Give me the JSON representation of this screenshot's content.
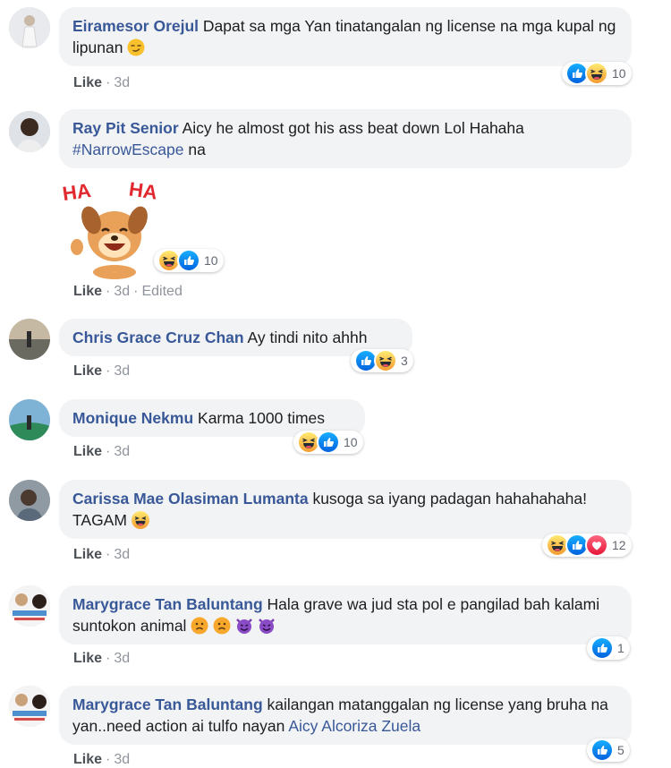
{
  "comments": [
    {
      "author": "Eiramesor Orejul",
      "text": "Dapat sa mga Yan tinatangalan ng license na mga kupal ng lipunan",
      "like": "Like",
      "time": "3d",
      "reaction_count": "10",
      "reactions": [
        "like-icon",
        "haha-icon"
      ]
    },
    {
      "author": "Ray Pit Senior",
      "text": "Aicy he almost got his ass beat down Lol Hahaha",
      "hashtag": "#NarrowEscape",
      "text_after": "na",
      "like": "Like",
      "time": "3d",
      "edited": "Edited",
      "sticker": "haha-dog-sticker",
      "sticker_text": "HA HA",
      "reaction_count": "10",
      "reactions": [
        "haha-icon",
        "like-icon"
      ]
    },
    {
      "author": "Chris Grace Cruz Chan",
      "text": "Ay tindi nito ahhh",
      "like": "Like",
      "time": "3d",
      "reaction_count": "3",
      "reactions": [
        "like-icon",
        "haha-icon"
      ]
    },
    {
      "author": "Monique Nekmu",
      "text": "Karma 1000 times",
      "like": "Like",
      "time": "3d",
      "reaction_count": "10",
      "reactions": [
        "haha-icon",
        "like-icon"
      ]
    },
    {
      "author": "Carissa Mae Olasiman Lumanta",
      "text": "kusoga sa iyang padagan hahahahaha! TAGAM",
      "like": "Like",
      "time": "3d",
      "reaction_count": "12",
      "reactions": [
        "haha-icon",
        "like-icon",
        "love-icon"
      ]
    },
    {
      "author": "Marygrace Tan Baluntang",
      "text": "Hala grave wa jud sta pol e pangilad bah kalami suntokon animal",
      "like": "Like",
      "time": "3d",
      "reaction_count": "1",
      "reactions": [
        "like-icon"
      ]
    },
    {
      "author": "Marygrace Tan Baluntang",
      "text": "kailangan matanggalan ng license yang bruha na yan..need action ai tulfo nayan",
      "mention": "Aicy Alcoriza Zuela",
      "like": "Like",
      "time": "3d",
      "reaction_count": "5",
      "reactions": [
        "like-icon"
      ]
    }
  ],
  "colors": {
    "author": "#385898",
    "bubble": "#f2f3f5",
    "like_blue": "#1877f2",
    "love_red": "#f33e58",
    "haha_yellow": "#f7b125"
  }
}
